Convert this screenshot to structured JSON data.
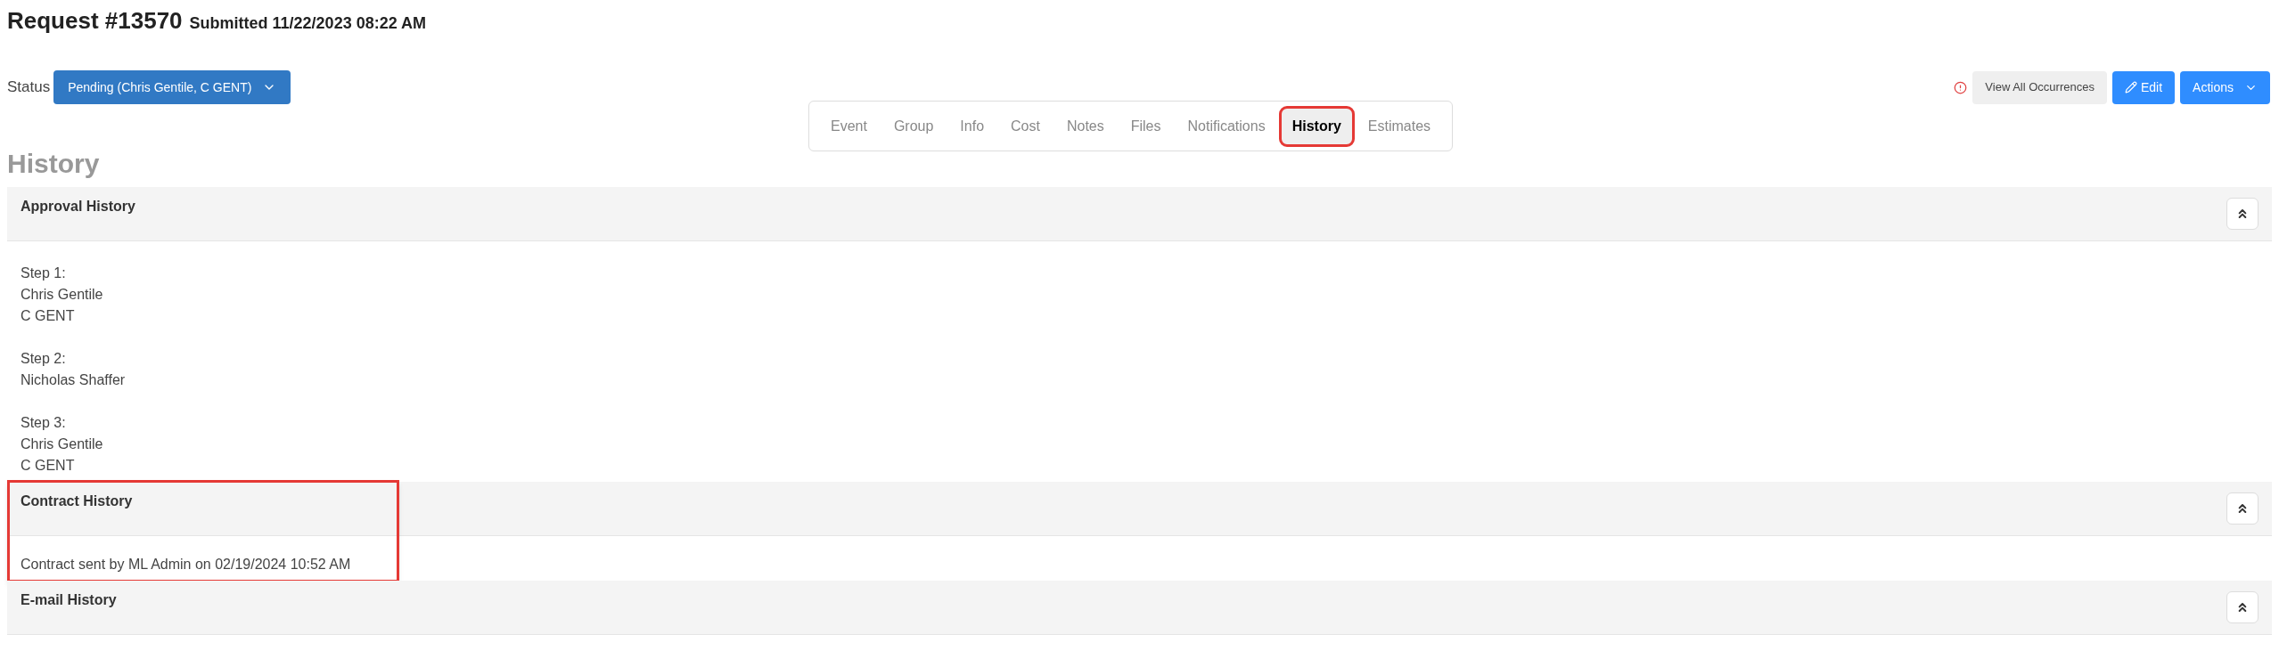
{
  "header": {
    "title": "Request #13570",
    "submitted": "Submitted 11/22/2023 08:22 AM"
  },
  "status": {
    "label": "Status",
    "value": "Pending (Chris Gentile, C GENT)"
  },
  "tabs": [
    {
      "label": "Event",
      "selected": false,
      "highlighted": false
    },
    {
      "label": "Group",
      "selected": false,
      "highlighted": false
    },
    {
      "label": "Info",
      "selected": false,
      "highlighted": false
    },
    {
      "label": "Cost",
      "selected": false,
      "highlighted": false
    },
    {
      "label": "Notes",
      "selected": false,
      "highlighted": false
    },
    {
      "label": "Files",
      "selected": false,
      "highlighted": false
    },
    {
      "label": "Notifications",
      "selected": false,
      "highlighted": false
    },
    {
      "label": "History",
      "selected": true,
      "highlighted": true
    },
    {
      "label": "Estimates",
      "selected": false,
      "highlighted": false
    }
  ],
  "actions": {
    "occurrences": "View All Occurrences",
    "edit": "Edit",
    "menu": "Actions"
  },
  "page_title": "History",
  "sections": [
    {
      "title": "Approval History",
      "expanded": true,
      "highlighted": false,
      "kind": "steps",
      "steps": [
        {
          "label": "Step 1:",
          "names": [
            "Chris Gentile",
            "C GENT"
          ]
        },
        {
          "label": "Step 2:",
          "names": [
            "Nicholas Shaffer"
          ]
        },
        {
          "label": "Step 3:",
          "names": [
            "Chris Gentile",
            "C GENT"
          ]
        }
      ]
    },
    {
      "title": "Contract History",
      "expanded": true,
      "highlighted": true,
      "kind": "lines",
      "lines": [
        "Contract sent by ML Admin on 02/19/2024 10:52 AM"
      ]
    },
    {
      "title": "E-mail History",
      "expanded": true,
      "highlighted": false,
      "kind": "lines"
    }
  ]
}
